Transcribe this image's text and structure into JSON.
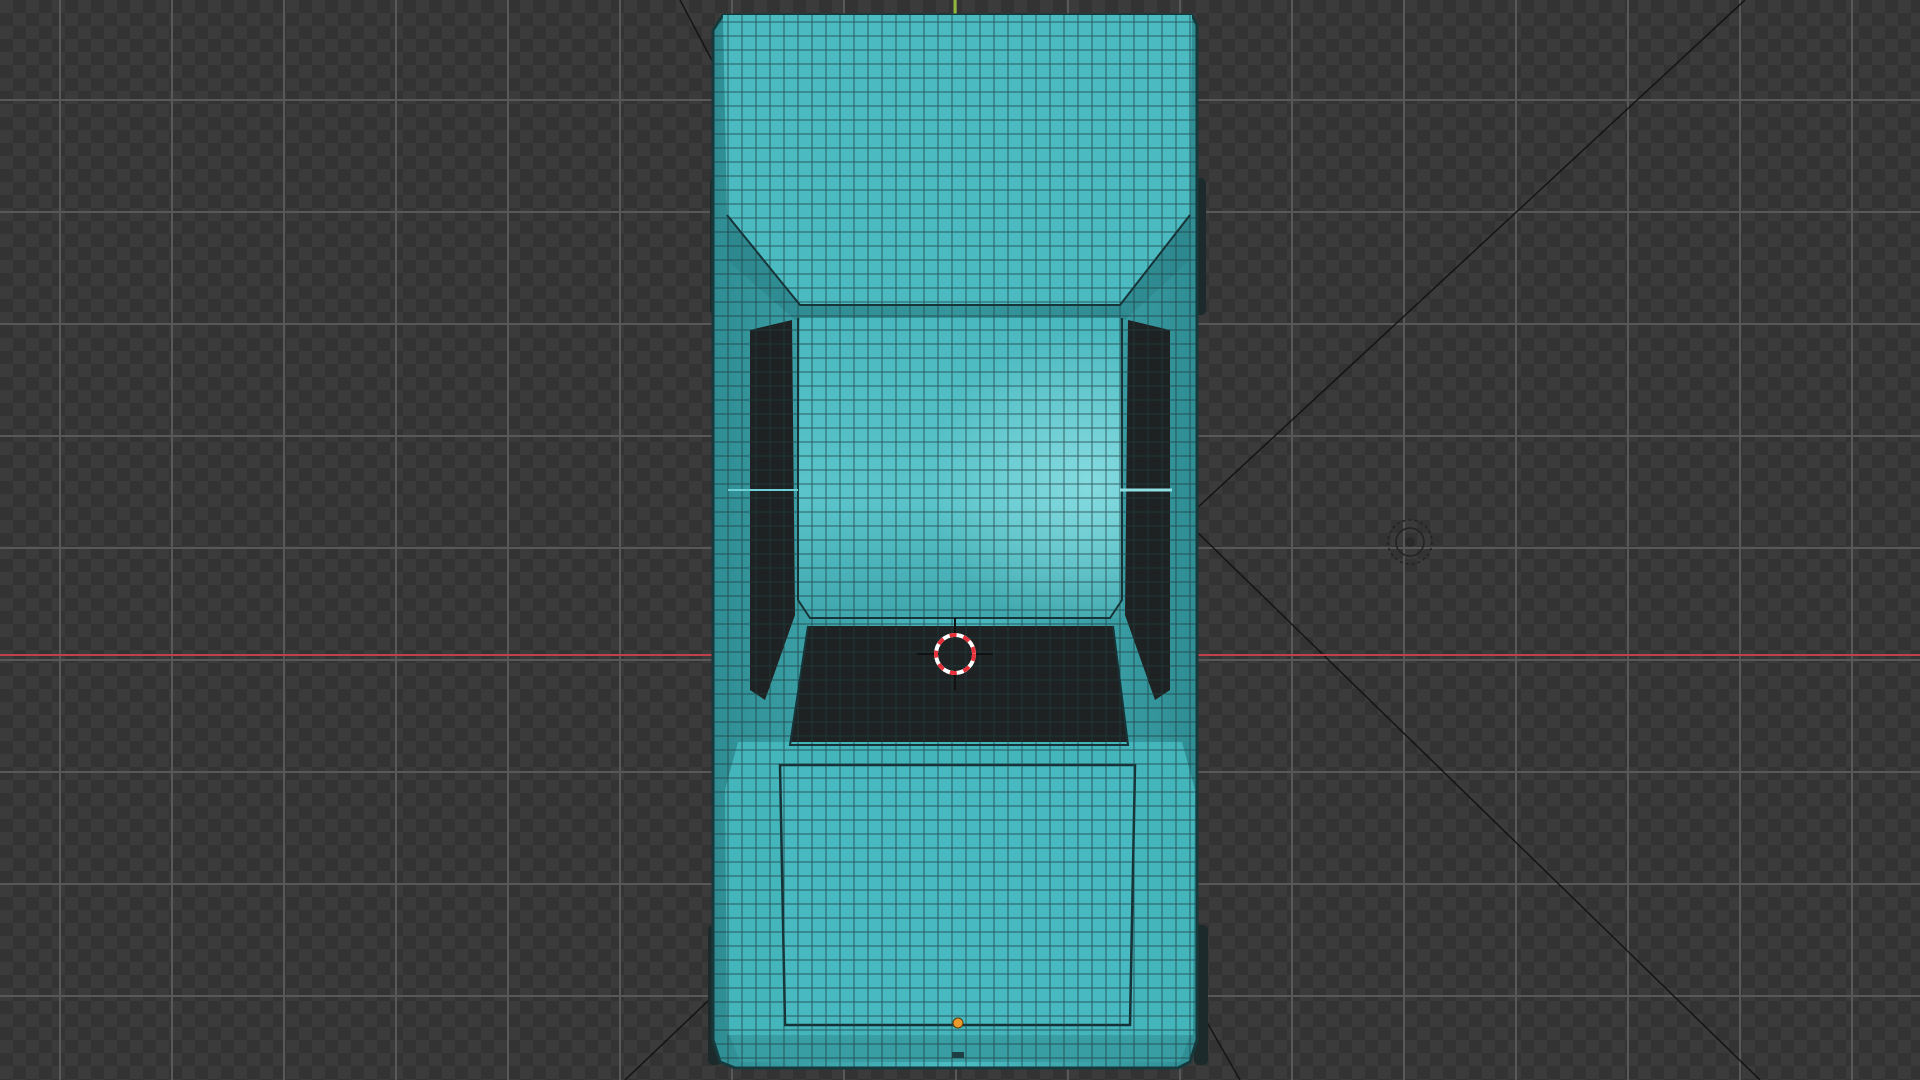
{
  "viewport": {
    "view": "top-orthographic",
    "object": "car-body-mesh",
    "shading": "solid-with-wireframe"
  },
  "colors": {
    "grid_line": "#585858",
    "x_axis": "#c0404c",
    "y_axis": "#8fb83a",
    "mesh_fill": "#45b6bd",
    "mesh_wire": "#1d3e42",
    "glass": "#1f2222",
    "cursor_red": "#e8303a",
    "origin_dot": "#e99a2b"
  },
  "icons": {
    "cursor": "3d-cursor-icon",
    "light": "light-object-icon",
    "origin": "object-origin-icon"
  }
}
